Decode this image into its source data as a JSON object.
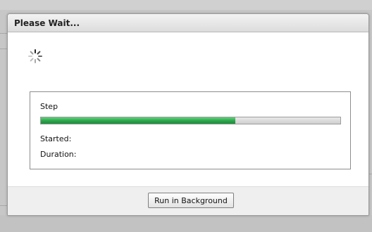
{
  "dialog": {
    "title": "Please Wait...",
    "spinner_icon": "loading-spinner-icon"
  },
  "progress": {
    "step_label": "Step",
    "fraction": 0.65,
    "fill_color": "#2ca34b",
    "started_label": "Started:",
    "duration_label": "Duration:"
  },
  "footer": {
    "run_background_label": "Run in Background"
  }
}
